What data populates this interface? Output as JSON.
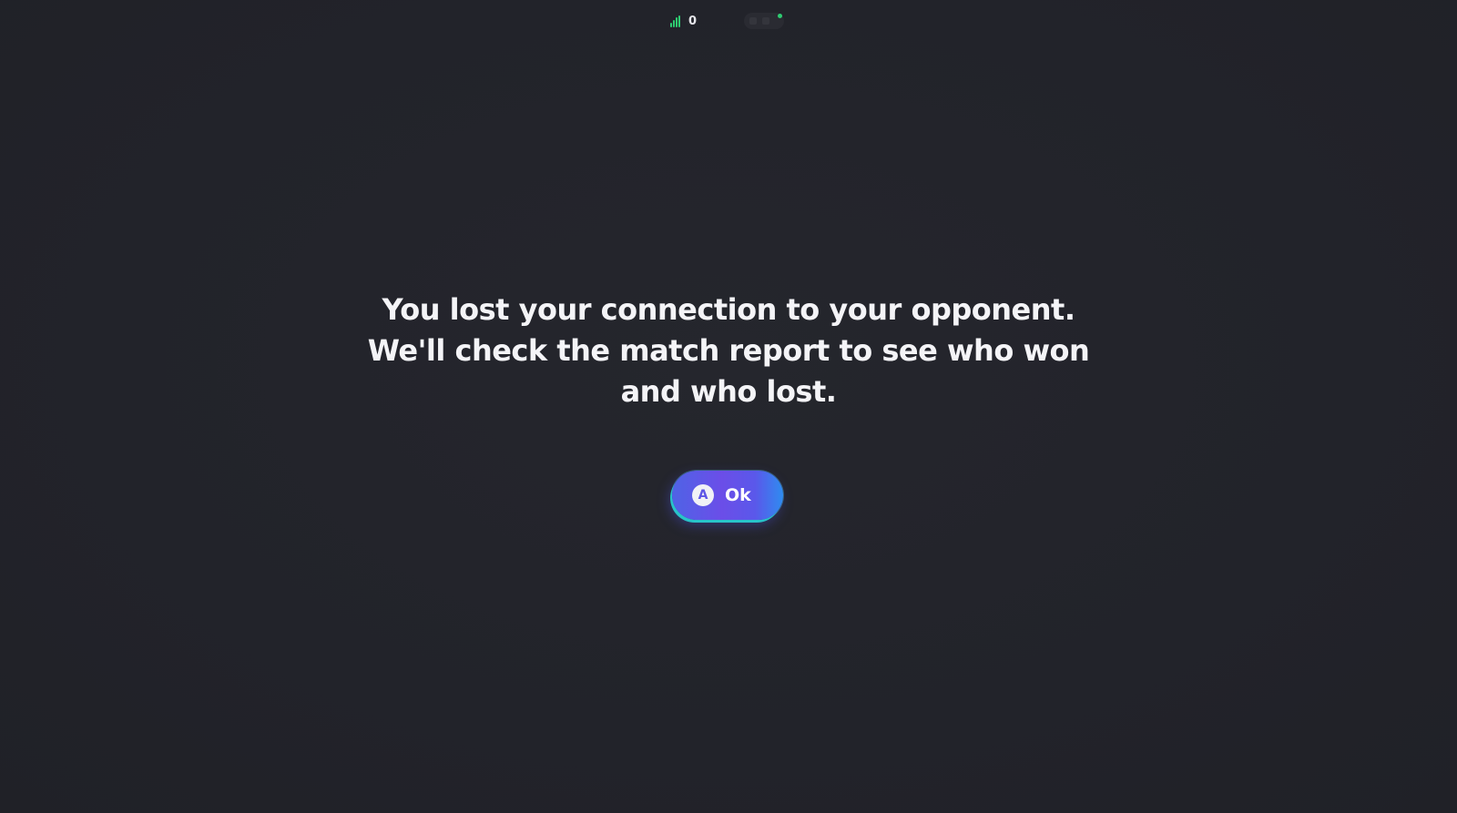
{
  "status_bar": {
    "ping_value": "0",
    "signal_icon": "signal-bars-icon",
    "online_color": "#2ecc71"
  },
  "dialog": {
    "message_line_1": "You lost your connection to your opponent.",
    "message_line_2": "We'll check the match report to see who won",
    "message_line_3": "and who lost.",
    "ok_button": {
      "glyph": "A",
      "label": "Ok",
      "gradient_colors": [
        "#4f63e6",
        "#6b4ee8",
        "#2f8cf0"
      ],
      "accent_color": "#28c3c9"
    }
  }
}
